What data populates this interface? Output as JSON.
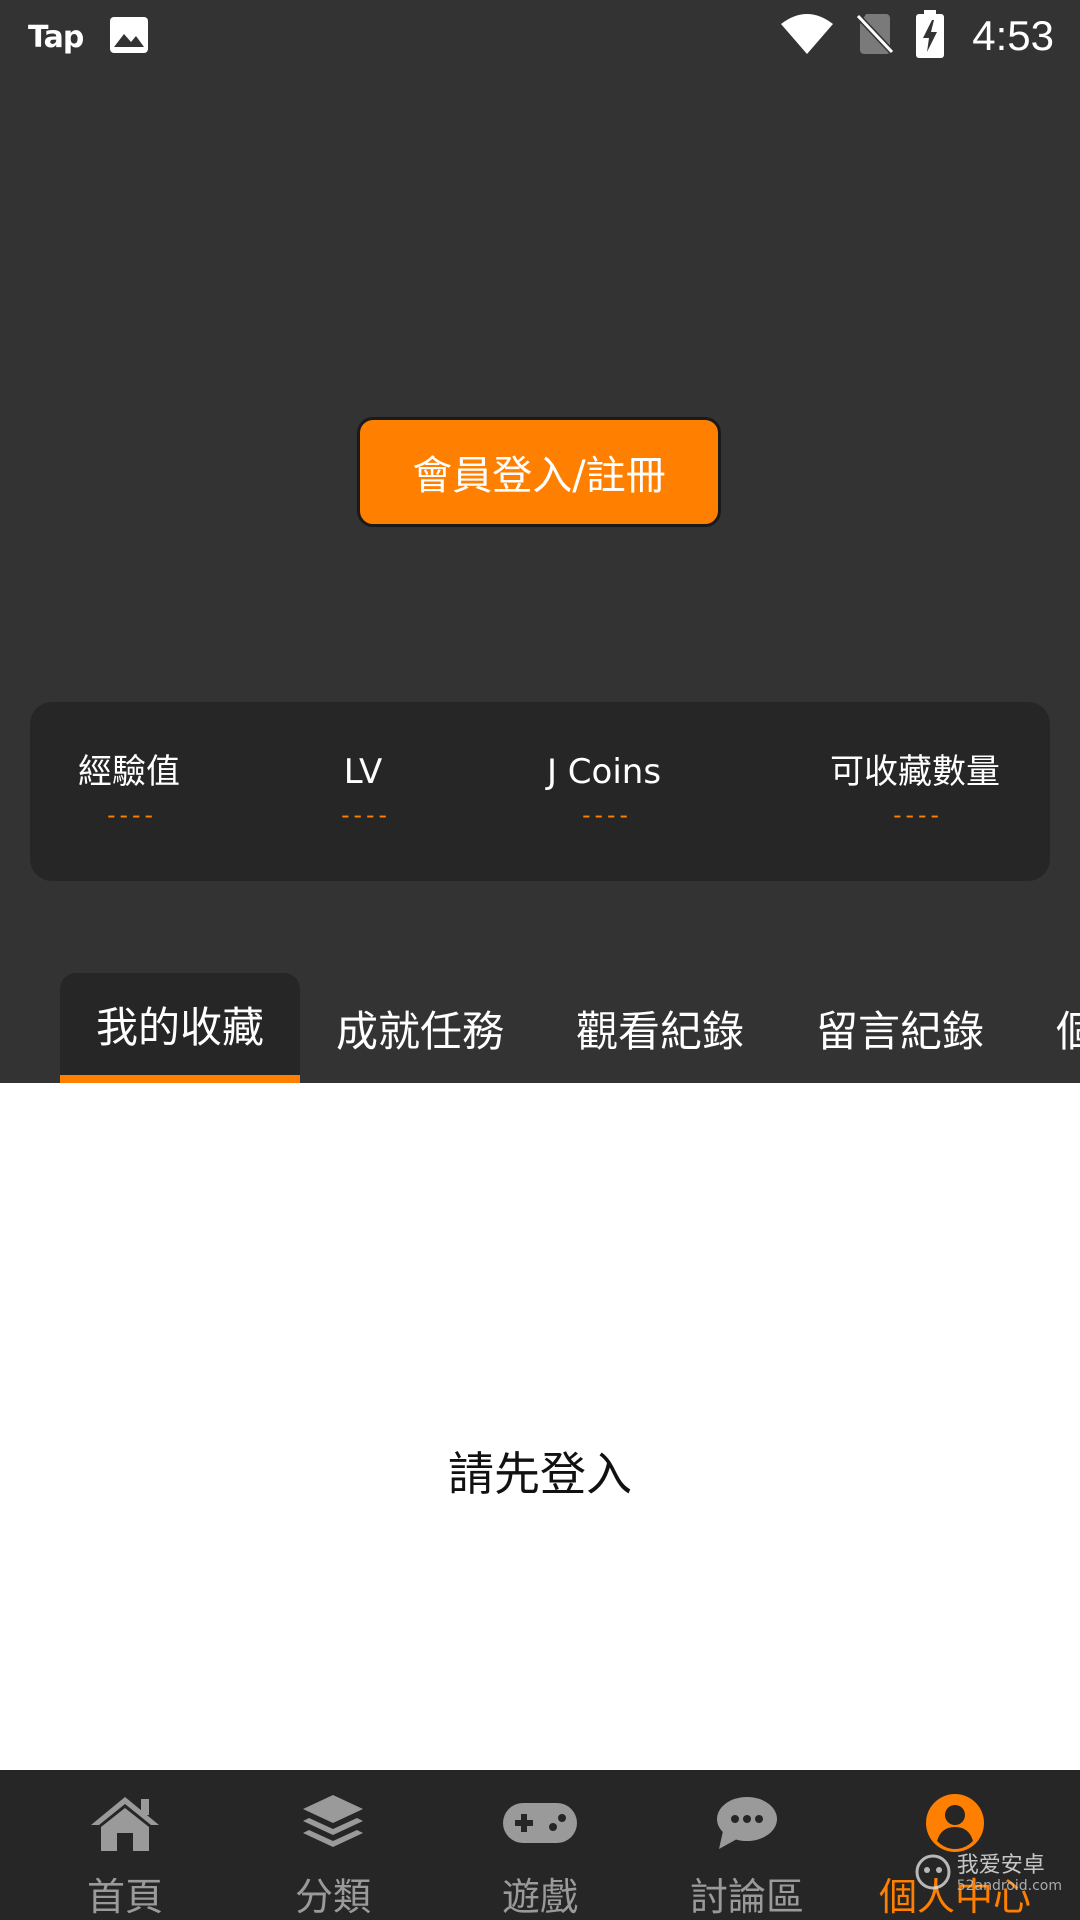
{
  "status_bar": {
    "app_logo": "Tap",
    "time": "4:53",
    "icons": [
      "image-icon",
      "wifi-icon",
      "no-sim-icon",
      "battery-charging-icon"
    ]
  },
  "header": {
    "login_button_label": "會員登入/註冊"
  },
  "stats": [
    {
      "label": "經驗值",
      "value": "----"
    },
    {
      "label": "LV",
      "value": "----"
    },
    {
      "label": "J Coins",
      "value": "----"
    },
    {
      "label": "可收藏數量",
      "value": "----"
    }
  ],
  "tabs": [
    {
      "label": "我的收藏",
      "active": true
    },
    {
      "label": "成就任務",
      "active": false
    },
    {
      "label": "觀看紀錄",
      "active": false
    },
    {
      "label": "留言紀錄",
      "active": false
    },
    {
      "label": "個",
      "active": false
    }
  ],
  "content": {
    "message": "請先登入"
  },
  "bottom_nav": [
    {
      "label": "首頁",
      "icon": "home-icon",
      "active": false
    },
    {
      "label": "分類",
      "icon": "layers-icon",
      "active": false
    },
    {
      "label": "遊戲",
      "icon": "gamepad-icon",
      "active": false
    },
    {
      "label": "討論區",
      "icon": "chat-bubble-icon",
      "active": false
    },
    {
      "label": "個人中心",
      "icon": "user-circle-icon",
      "active": true
    }
  ],
  "watermark": {
    "text": "我爱安卓",
    "sub": "52android.com"
  },
  "colors": {
    "accent": "#ff7f00",
    "background": "#333333",
    "card": "#262626",
    "content_bg": "#ffffff",
    "nav_inactive": "#9a9a9a"
  }
}
